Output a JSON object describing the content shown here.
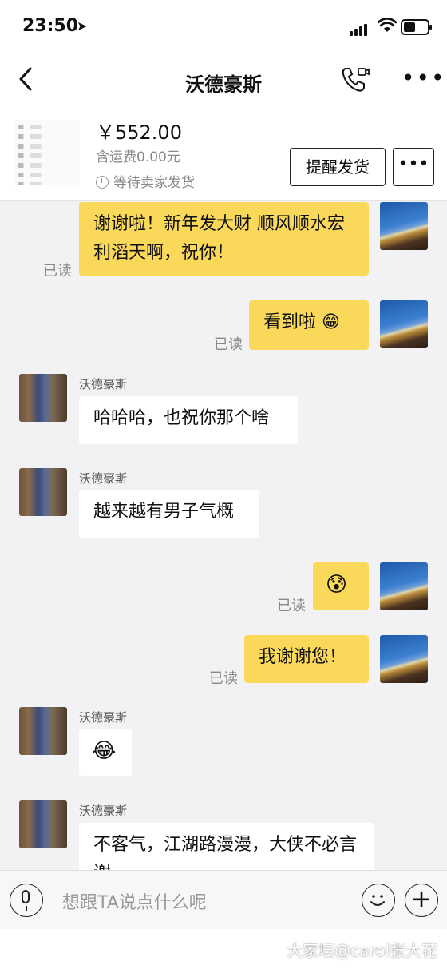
{
  "status_bar": {
    "time": "23:50",
    "location_icon": "location-arrow-icon"
  },
  "nav": {
    "title": "沃德豪斯",
    "back_icon": "chevron-left-icon",
    "call_icon": "phone-video-icon",
    "more_icon": "more-icon"
  },
  "product": {
    "price": "￥552.00",
    "shipping": "含运费0.00元",
    "status": "等待卖家发货",
    "remind_button": "提醒发货",
    "more_button": "•••"
  },
  "messages": [
    {
      "from": "me",
      "text": "谢谢啦！新年发大财 顺风顺水宏利滔天啊，祝你！",
      "read": "已读"
    },
    {
      "from": "me",
      "text": "看到啦 😁",
      "read": "已读"
    },
    {
      "from": "other",
      "sender": "沃德豪斯",
      "text": "哈哈哈，也祝你那个啥"
    },
    {
      "from": "other",
      "sender": "沃德豪斯",
      "text": "越来越有男子气概"
    },
    {
      "from": "me",
      "text": "😰",
      "read": "已读"
    },
    {
      "from": "me",
      "text": "我谢谢您！",
      "read": "已读"
    },
    {
      "from": "other",
      "sender": "沃德豪斯",
      "text": "😂"
    },
    {
      "from": "other",
      "sender": "沃德豪斯",
      "text": "不客气，江湖路漫漫，大侠不必言谢"
    }
  ],
  "input": {
    "placeholder": "想跟TA说点什么呢"
  },
  "watermark": "大家坛@carol张大花",
  "colors": {
    "my_bubble": "#fad85a",
    "other_bubble": "#ffffff",
    "chat_bg": "#f2f2f4"
  }
}
